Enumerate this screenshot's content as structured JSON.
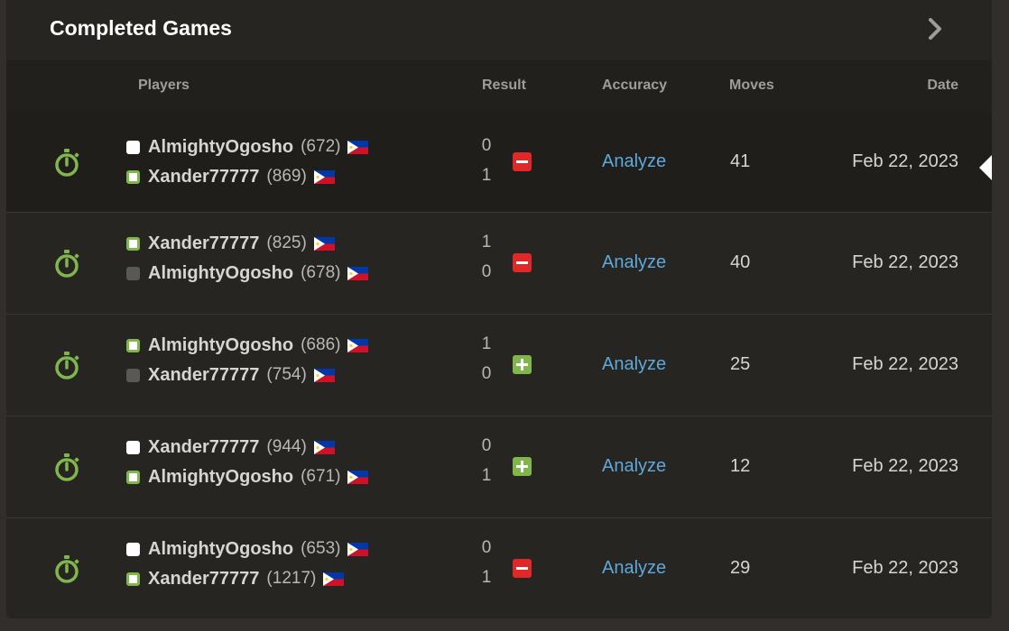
{
  "header": {
    "title": "Completed Games"
  },
  "columns": {
    "players": "Players",
    "result": "Result",
    "accuracy": "Accuracy",
    "moves": "Moves",
    "date": "Date"
  },
  "colors": {
    "win": "#81b64c",
    "loss": "#e02828",
    "link": "#5fa8da"
  },
  "games": [
    {
      "selected": true,
      "p1": {
        "name": "AlmightyOgosho",
        "rating": "(672)",
        "piece": "white",
        "won": false,
        "score": "0"
      },
      "p2": {
        "name": "Xander77777",
        "rating": "(869)",
        "piece": "white",
        "won": true,
        "score": "1"
      },
      "result": "loss",
      "accuracy": "Analyze",
      "moves": "41",
      "date": "Feb 22, 2023"
    },
    {
      "p1": {
        "name": "Xander77777",
        "rating": "(825)",
        "piece": "white",
        "won": true,
        "score": "1"
      },
      "p2": {
        "name": "AlmightyOgosho",
        "rating": "(678)",
        "piece": "black",
        "won": false,
        "score": "0"
      },
      "result": "loss",
      "accuracy": "Analyze",
      "moves": "40",
      "date": "Feb 22, 2023"
    },
    {
      "p1": {
        "name": "AlmightyOgosho",
        "rating": "(686)",
        "piece": "white",
        "won": true,
        "score": "1"
      },
      "p2": {
        "name": "Xander77777",
        "rating": "(754)",
        "piece": "black",
        "won": false,
        "score": "0"
      },
      "result": "win",
      "accuracy": "Analyze",
      "moves": "25",
      "date": "Feb 22, 2023"
    },
    {
      "p1": {
        "name": "Xander77777",
        "rating": "(944)",
        "piece": "white",
        "won": false,
        "score": "0"
      },
      "p2": {
        "name": "AlmightyOgosho",
        "rating": "(671)",
        "piece": "white",
        "won": true,
        "score": "1"
      },
      "result": "win",
      "accuracy": "Analyze",
      "moves": "12",
      "date": "Feb 22, 2023"
    },
    {
      "p1": {
        "name": "AlmightyOgosho",
        "rating": "(653)",
        "piece": "white",
        "won": false,
        "score": "0"
      },
      "p2": {
        "name": "Xander77777",
        "rating": "(1217)",
        "piece": "white",
        "won": true,
        "score": "1"
      },
      "result": "loss",
      "accuracy": "Analyze",
      "moves": "29",
      "date": "Feb 22, 2023"
    }
  ]
}
